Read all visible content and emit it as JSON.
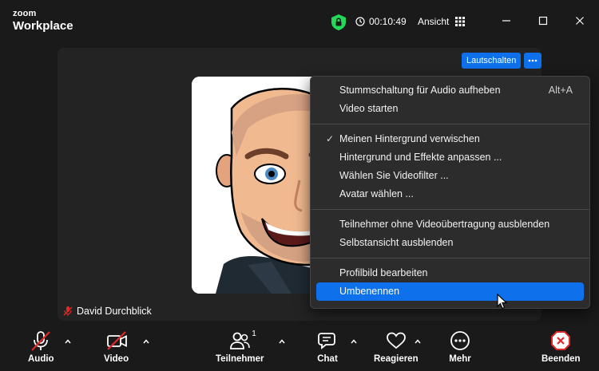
{
  "app": {
    "logo_line1": "zoom",
    "logo_line2": "Workplace",
    "timer": "00:10:49",
    "view_label": "Ansicht"
  },
  "icons": {
    "shield": "shield-lock-icon",
    "timer": "clock-icon",
    "view": "grid-icon",
    "minimize": "minimize-icon",
    "maximize": "maximize-icon",
    "close": "close-icon"
  },
  "participant": {
    "name": "David Durchblick",
    "mute_button": "Lautschalten"
  },
  "menu": {
    "groups": [
      [
        {
          "label": "Stummschaltung für Audio aufheben",
          "shortcut": "Alt+A"
        },
        {
          "label": "Video starten"
        }
      ],
      [
        {
          "label": "Meinen Hintergrund verwischen",
          "checked": true
        },
        {
          "label": "Hintergrund und Effekte anpassen ..."
        },
        {
          "label": "Wählen Sie Videofilter ..."
        },
        {
          "label": "Avatar wählen ..."
        }
      ],
      [
        {
          "label": "Teilnehmer ohne Videoübertragung ausblenden"
        },
        {
          "label": "Selbstansicht ausblenden"
        }
      ],
      [
        {
          "label": "Profilbild bearbeiten"
        },
        {
          "label": "Umbenennen",
          "selected": true
        }
      ]
    ]
  },
  "toolbar": {
    "audio": "Audio",
    "video": "Video",
    "participants": "Teilnehmer",
    "participants_count": "1",
    "chat": "Chat",
    "reactions": "Reagieren",
    "more": "Mehr",
    "end": "Beenden"
  },
  "colors": {
    "accent": "#0e71eb",
    "end": "#e02828",
    "shield": "#23d959",
    "muted": "#e02828"
  }
}
